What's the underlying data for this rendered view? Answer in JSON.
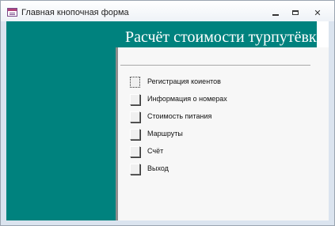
{
  "window": {
    "title": "Главная кнопочная форма",
    "icon": "access-form-icon"
  },
  "header": {
    "title": "Расчёт стоимости турпутёвки"
  },
  "menu": {
    "items": [
      {
        "label": "Регистрация коиентов",
        "focused": true
      },
      {
        "label": "Информация о номерах",
        "focused": false
      },
      {
        "label": "Стоимость питания",
        "focused": false
      },
      {
        "label": "Маршруты",
        "focused": false
      },
      {
        "label": "Счёт",
        "focused": false
      },
      {
        "label": "Выход",
        "focused": false
      }
    ]
  },
  "colors": {
    "accent": "#00827e",
    "panel": "#f7f7f7"
  }
}
